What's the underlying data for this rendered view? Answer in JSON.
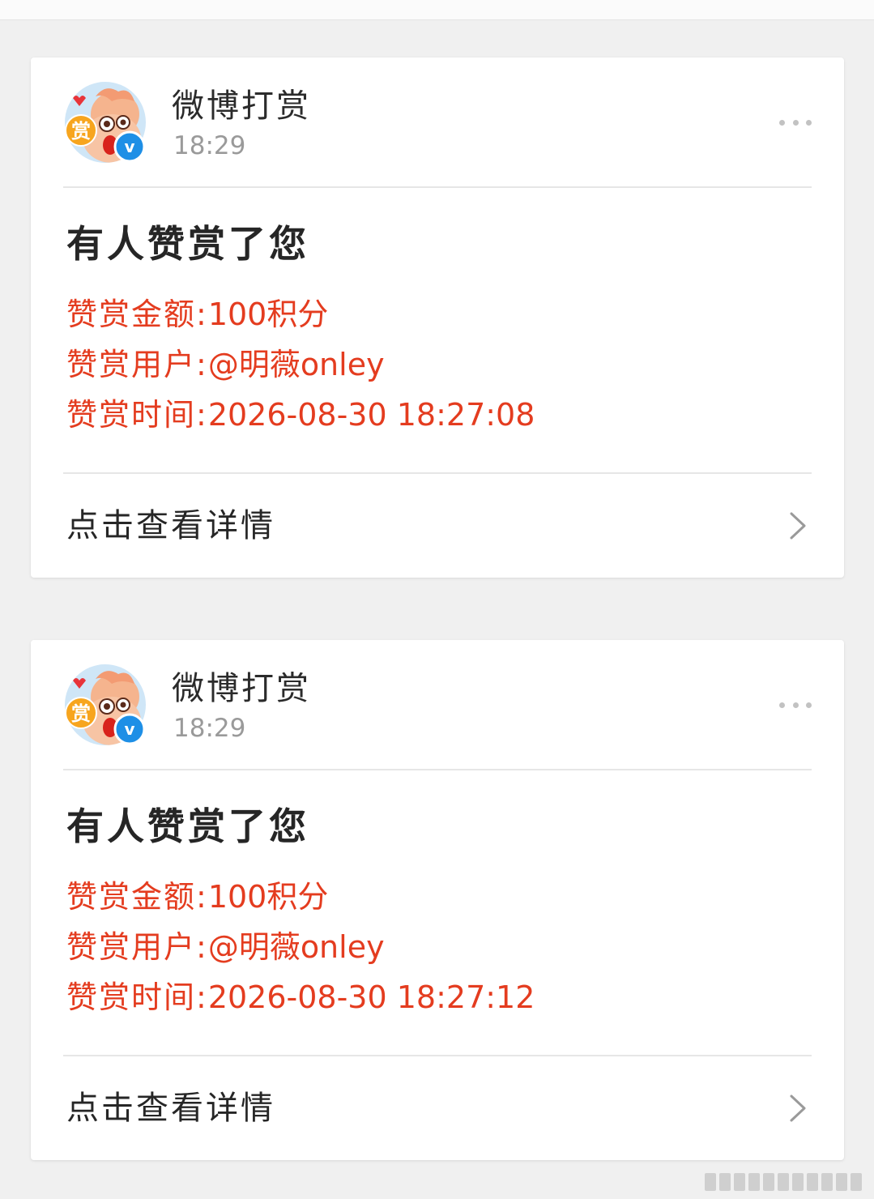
{
  "colors": {
    "page_bg": "#f0f0f0",
    "card_bg": "#ffffff",
    "accent_red": "#e43c1f",
    "verified_blue": "#1e8fe6",
    "title_text": "#262626",
    "time_text": "#9a9a9a"
  },
  "messages": [
    {
      "sender": {
        "name": "微博打赏",
        "time": "18:29",
        "avatar_icon": "reward-mascot-avatar",
        "avatar_badge": "赏",
        "verified_badge": "v"
      },
      "title": "有人赞赏了您",
      "details": [
        {
          "label": "赞赏金额:",
          "value": "100积分"
        },
        {
          "label": "赞赏用户:",
          "value": "@明薇onley"
        },
        {
          "label": "赞赏时间:",
          "value": "2026-08-30 18:27:08"
        }
      ],
      "footer_label": "点击查看详情"
    },
    {
      "sender": {
        "name": "微博打赏",
        "time": "18:29",
        "avatar_icon": "reward-mascot-avatar",
        "avatar_badge": "赏",
        "verified_badge": "v"
      },
      "title": "有人赞赏了您",
      "details": [
        {
          "label": "赞赏金额:",
          "value": "100积分"
        },
        {
          "label": "赞赏用户:",
          "value": "@明薇onley"
        },
        {
          "label": "赞赏时间:",
          "value": "2026-08-30 18:27:12"
        }
      ],
      "footer_label": "点击查看详情"
    }
  ]
}
